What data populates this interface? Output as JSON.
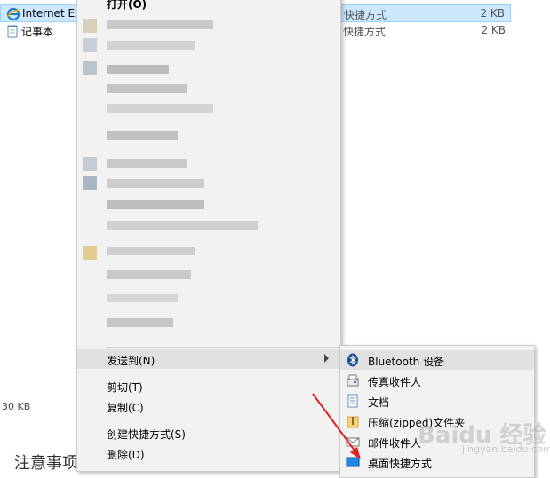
{
  "files": [
    {
      "name": "Internet Ex",
      "type": "快捷方式",
      "size": "2 KB",
      "icon": "internet-explorer-icon",
      "selected": true
    },
    {
      "name": "记事本",
      "type": "快捷方式",
      "size": "2 KB",
      "icon": "notepad-icon",
      "selected": false
    }
  ],
  "status": {
    "size": "30 KB"
  },
  "note": "注意事项",
  "context_menu": {
    "open": "打开(O)",
    "send_to": "发送到(N)",
    "cut": "剪切(T)",
    "copy": "复制(C)",
    "create_shortcut": "创建快捷方式(S)",
    "delete": "删除(D)"
  },
  "submenu": {
    "items": [
      {
        "label": "Bluetooth 设备",
        "icon": "bluetooth-icon"
      },
      {
        "label": "传真收件人",
        "icon": "fax-icon"
      },
      {
        "label": "文档",
        "icon": "documents-icon"
      },
      {
        "label": "压缩(zipped)文件夹",
        "icon": "zip-folder-icon"
      },
      {
        "label": "邮件收件人",
        "icon": "mail-icon"
      },
      {
        "label": "桌面快捷方式",
        "icon": "desktop-icon"
      }
    ]
  },
  "watermark": {
    "brand": "Baidu 经验",
    "url": "jingyan.baidu.com"
  },
  "colors": {
    "selection": "#cce8ff",
    "menu_bg": "#f2f2f2",
    "hover": "#e1e1e1",
    "arrow": "#e02020"
  }
}
